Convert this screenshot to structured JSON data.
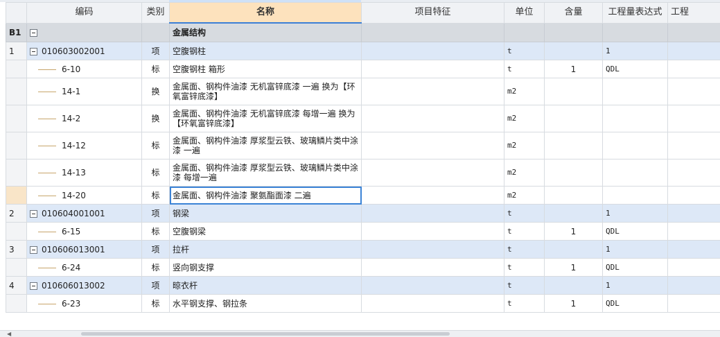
{
  "columns": [
    "编码",
    "类别",
    "名称",
    "项目特征",
    "单位",
    "含量",
    "工程量表达式",
    "工程量"
  ],
  "columns_visible": [
    "编码",
    "类别",
    "名称",
    "项目特征",
    "单位",
    "含量",
    "工程量表达式",
    "工程"
  ],
  "section": {
    "id": "B1",
    "name": "金属结构"
  },
  "rows": [
    {
      "num": "1",
      "code": "010603002001",
      "type": "项",
      "name": "空腹钢柱",
      "unit": "t",
      "qty": "",
      "expr": "1",
      "level": "item"
    },
    {
      "num": "",
      "code": "6-10",
      "type": "标",
      "name": "空腹钢柱 箱形",
      "unit": "t",
      "qty": "1",
      "expr": "QDL",
      "level": "sub"
    },
    {
      "num": "",
      "code": "14-1",
      "type": "换",
      "name": "金属面、钢构件油漆 无机富锌底漆 一遍 换为【环氧富锌底漆】",
      "unit": "m2",
      "qty": "",
      "expr": "",
      "level": "sub-tall"
    },
    {
      "num": "",
      "code": "14-2",
      "type": "换",
      "name": "金属面、钢构件油漆 无机富锌底漆 每增一遍 换为【环氧富锌底漆】",
      "unit": "m2",
      "qty": "",
      "expr": "",
      "level": "sub-tall"
    },
    {
      "num": "",
      "code": "14-12",
      "type": "标",
      "name": "金属面、钢构件油漆 厚浆型云铁、玻璃鳞片类中涂漆 一遍",
      "unit": "m2",
      "qty": "",
      "expr": "",
      "level": "sub-tall"
    },
    {
      "num": "",
      "code": "14-13",
      "type": "标",
      "name": "金属面、钢构件油漆 厚浆型云铁、玻璃鳞片类中涂漆 每增一遍",
      "unit": "m2",
      "qty": "",
      "expr": "",
      "level": "sub-tall"
    },
    {
      "num": "",
      "code": "14-20",
      "type": "标",
      "name": "金属面、钢构件油漆 聚氨酯面漆 二遍",
      "unit": "m2",
      "qty": "",
      "expr": "",
      "level": "sub-selected"
    },
    {
      "num": "2",
      "code": "010604001001",
      "type": "项",
      "name": "钢梁",
      "unit": "t",
      "qty": "",
      "expr": "1",
      "level": "item"
    },
    {
      "num": "",
      "code": "6-15",
      "type": "标",
      "name": "空腹钢梁",
      "unit": "t",
      "qty": "1",
      "expr": "QDL",
      "level": "sub"
    },
    {
      "num": "3",
      "code": "010606013001",
      "type": "项",
      "name": "拉杆",
      "unit": "t",
      "qty": "",
      "expr": "1",
      "level": "item"
    },
    {
      "num": "",
      "code": "6-24",
      "type": "标",
      "name": "竖向钢支撑",
      "unit": "t",
      "qty": "1",
      "expr": "QDL",
      "level": "sub"
    },
    {
      "num": "4",
      "code": "010606013002",
      "type": "项",
      "name": "晾衣杆",
      "unit": "t",
      "qty": "",
      "expr": "1",
      "level": "item"
    },
    {
      "num": "",
      "code": "6-23",
      "type": "标",
      "name": "水平钢支撑、钢拉条",
      "unit": "t",
      "qty": "1",
      "expr": "QDL",
      "level": "sub"
    }
  ],
  "colors": {
    "header_bg": "#f0f2f5",
    "active_header_bg": "#fde2bd",
    "item_row_bg": "#dde8f7",
    "section_bg": "#d7dbe0",
    "selection": "#3b83d6"
  }
}
